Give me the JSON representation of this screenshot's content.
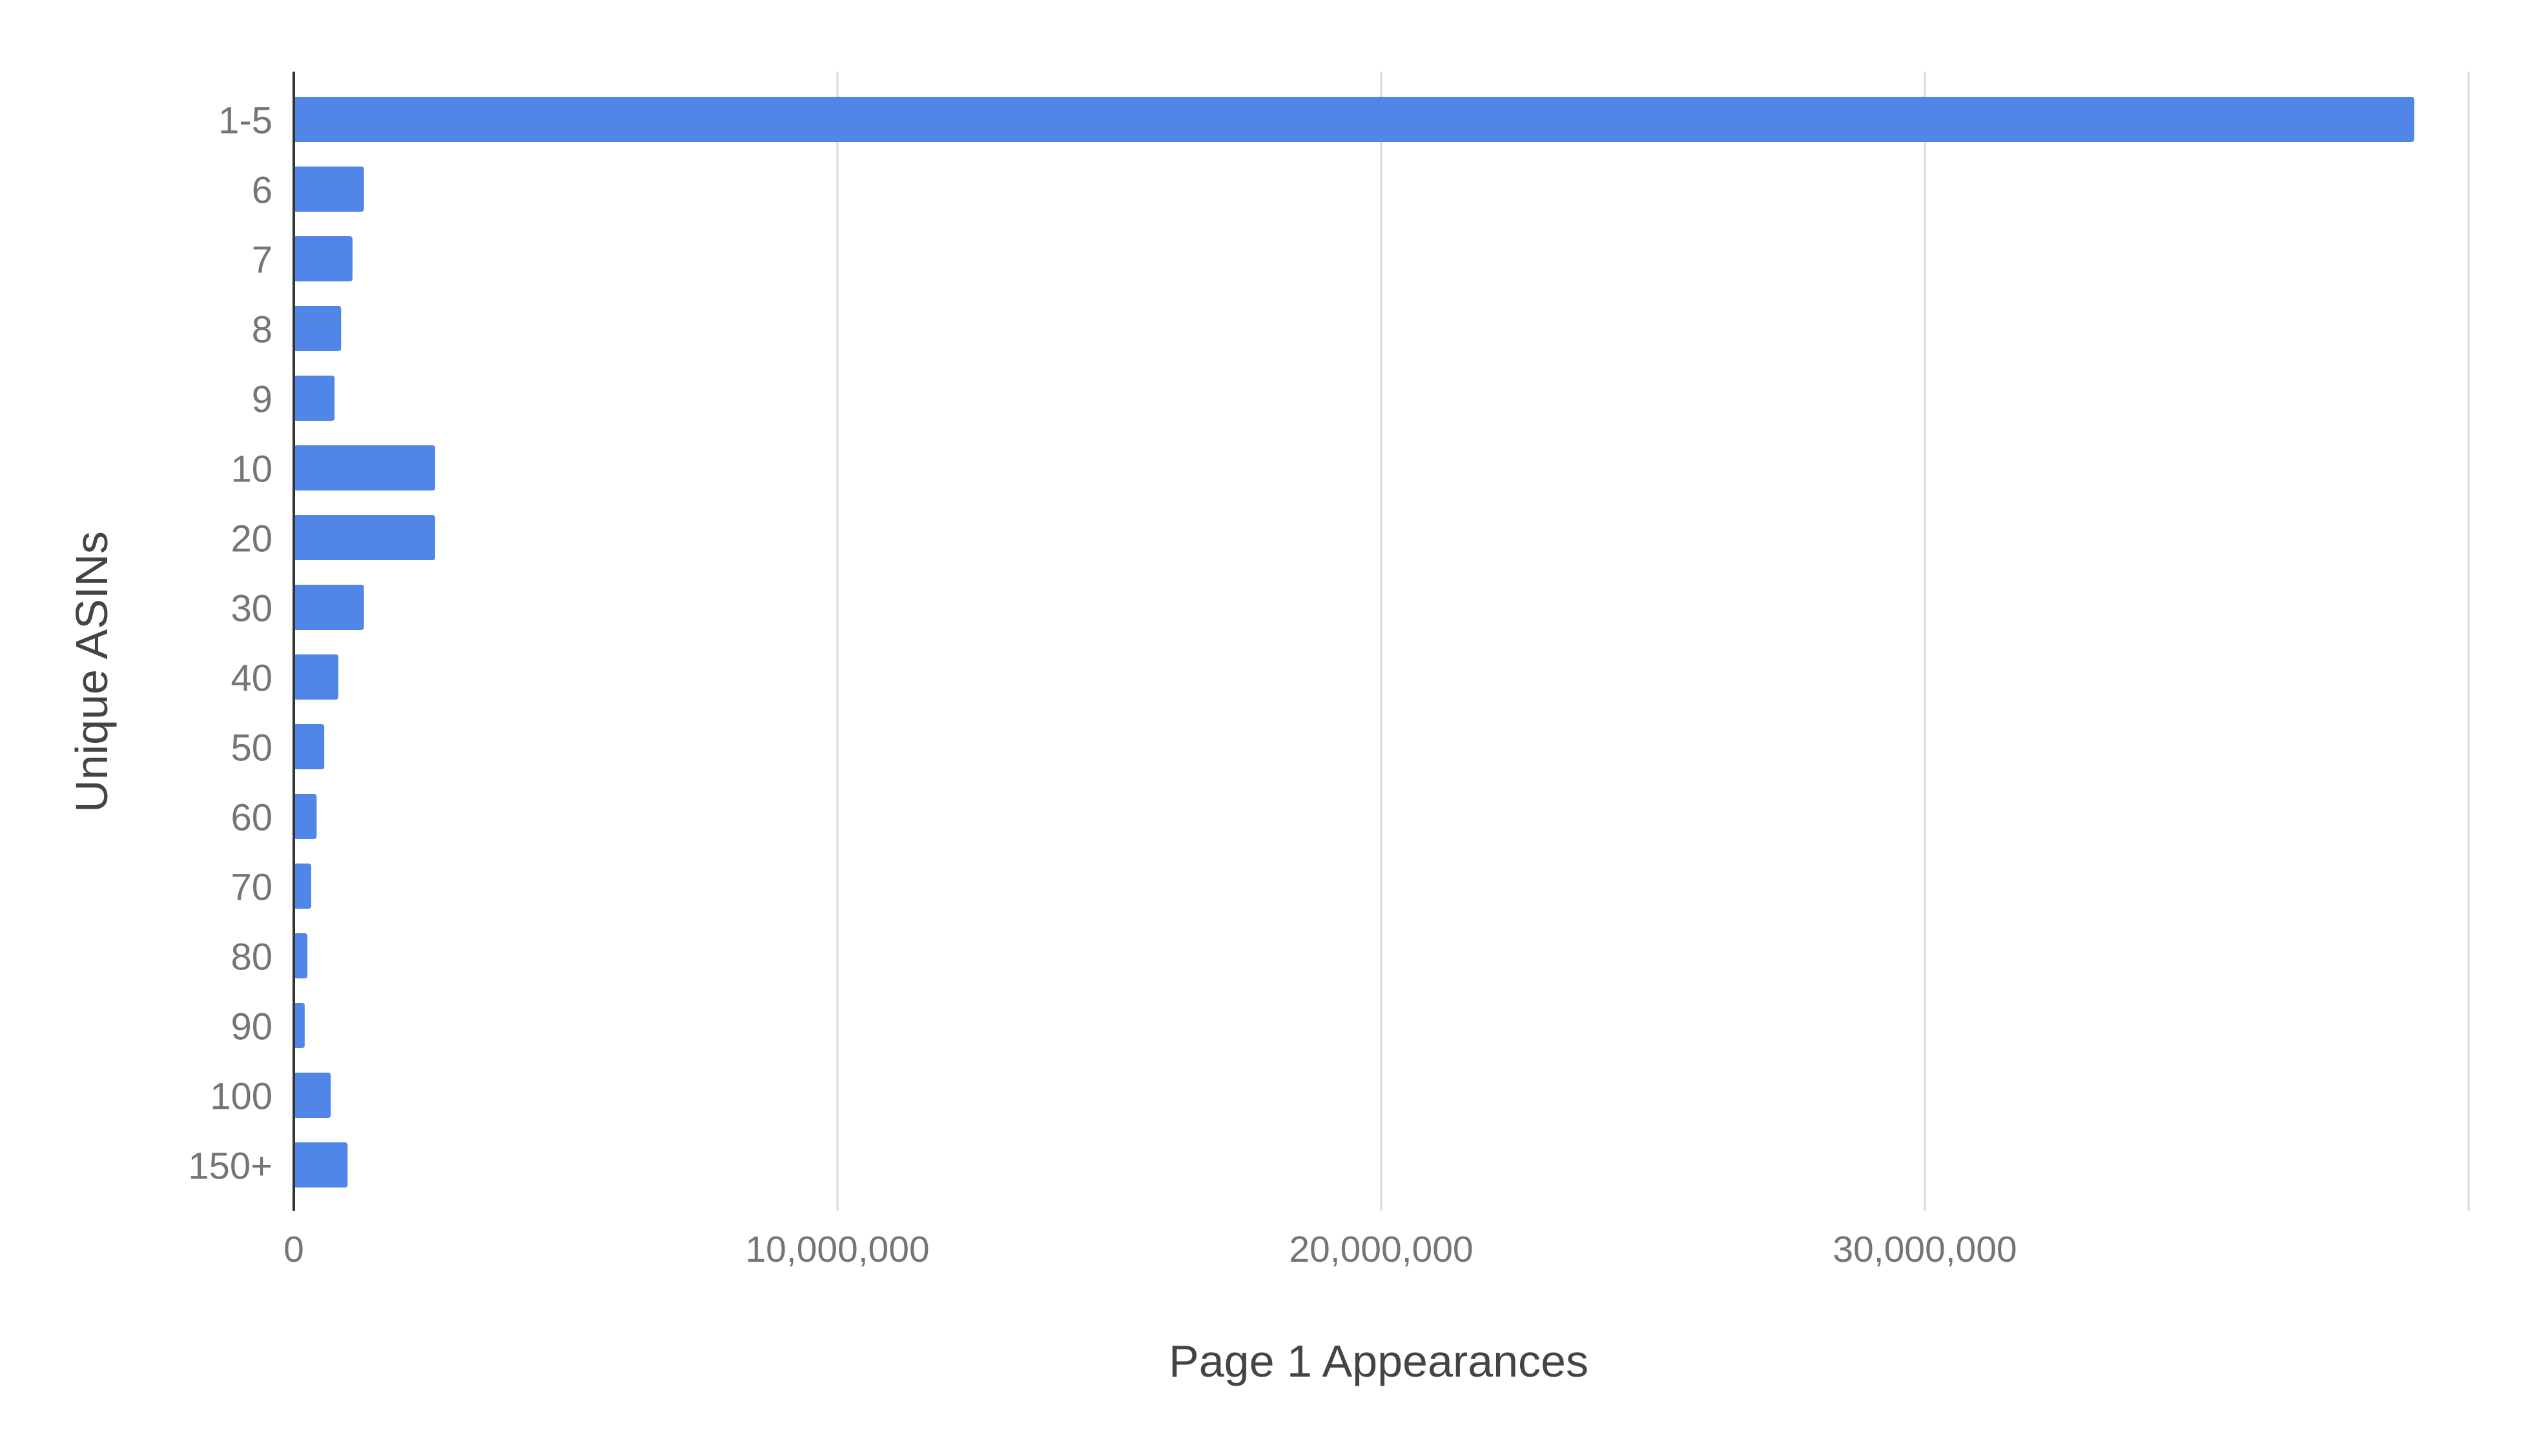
{
  "chart_data": {
    "type": "bar",
    "orientation": "horizontal",
    "title": "",
    "xlabel": "Page 1 Appearances",
    "ylabel": "Unique ASINs",
    "categories": [
      "1-5",
      "6",
      "7",
      "8",
      "9",
      "10",
      "20",
      "30",
      "40",
      "50",
      "60",
      "70",
      "80",
      "90",
      "100",
      "150+"
    ],
    "series": [
      {
        "name": "Page 1 Appearances",
        "color": "#5086E8",
        "values": [
          39000000,
          1290000,
          1080000,
          870000,
          750000,
          2600000,
          2600000,
          1290000,
          820000,
          560000,
          420000,
          320000,
          250000,
          200000,
          680000,
          990000
        ]
      }
    ],
    "xlim": [
      0,
      40000000
    ],
    "x_ticks": [
      0,
      10000000,
      20000000,
      30000000,
      40000000
    ],
    "x_tick_labels": [
      "0",
      "10,000,000",
      "20,000,000",
      "30,000,000",
      ""
    ],
    "grid": "vertical",
    "legend": "none"
  }
}
